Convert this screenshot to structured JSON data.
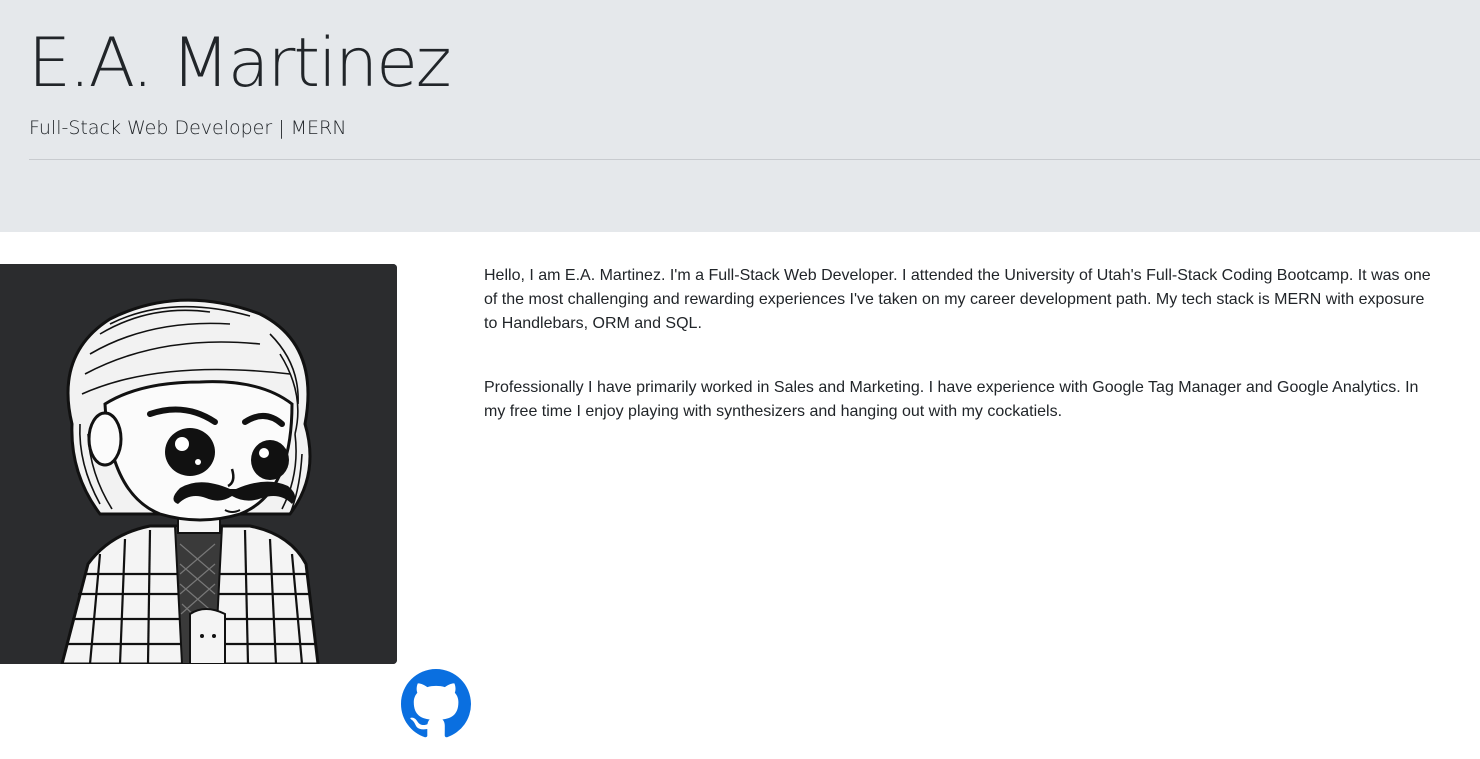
{
  "header": {
    "name": "E.A. Martinez",
    "tagline": "Full-Stack Web Developer | MERN"
  },
  "about": {
    "paragraphs": [
      "Hello, I am E.A. Martinez. I'm a Full-Stack Web Developer. I attended the University of Utah's Full-Stack Coding Bootcamp. It was one of the most challenging and rewarding experiences I've taken on my career development path. My tech stack is MERN with exposure to Handlebars, ORM and SQL.",
      "Professionally I have primarily worked in Sales and Marketing. I have experience with Google Tag Manager and Google Analytics. In my free time I enjoy playing with synthesizers and hanging out with my cockatiels."
    ]
  },
  "avatar": {
    "icon": "cartoon-portrait-illustration"
  },
  "links": {
    "github_icon": "github-icon",
    "github_color": "#0a6fe0"
  },
  "colors": {
    "jumbotron_bg": "#e5e8eb",
    "avatar_bg": "#2b2c2e",
    "text": "#212529"
  }
}
